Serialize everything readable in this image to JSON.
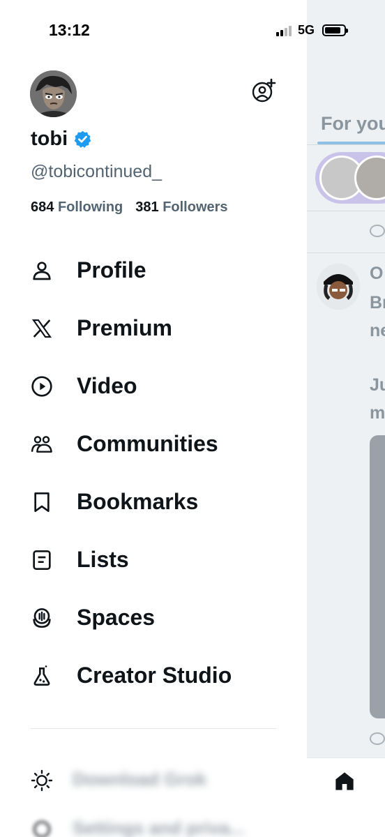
{
  "status_bar": {
    "time": "13:12",
    "network": "5G"
  },
  "profile": {
    "display_name": "tobi",
    "handle": "@tobicontinued_",
    "following_count": "684",
    "following_label": "Following",
    "followers_count": "381",
    "followers_label": "Followers"
  },
  "menu": [
    {
      "label": "Profile",
      "icon": "person-icon"
    },
    {
      "label": "Premium",
      "icon": "x-logo-icon"
    },
    {
      "label": "Video",
      "icon": "play-circle-icon"
    },
    {
      "label": "Communities",
      "icon": "people-icon"
    },
    {
      "label": "Bookmarks",
      "icon": "bookmark-icon"
    },
    {
      "label": "Lists",
      "icon": "list-icon"
    },
    {
      "label": "Spaces",
      "icon": "spaces-mic-icon"
    },
    {
      "label": "Creator Studio",
      "icon": "flask-icon"
    }
  ],
  "bottom_items": [
    {
      "label": "Download Grok",
      "icon": "sun-icon"
    },
    {
      "label": "Settings and priva...",
      "icon": "settings-icon"
    }
  ],
  "feed": {
    "tab": "For you",
    "post_lines": [
      "O",
      "Br",
      "ne",
      "Ju",
      "m"
    ]
  },
  "colors": {
    "accent": "#1d9bf0",
    "text": "#0f1419",
    "secondary": "#536471",
    "feed_bg": "#eef1f4"
  }
}
